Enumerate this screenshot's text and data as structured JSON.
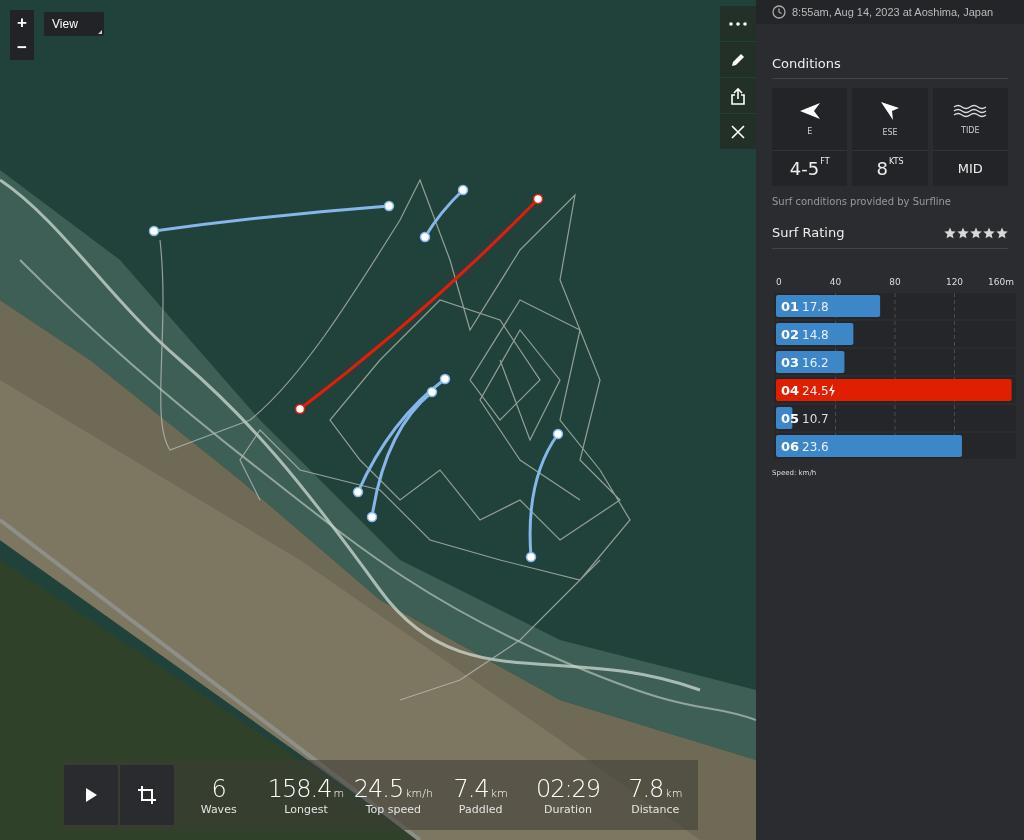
{
  "map_controls": {
    "zoom_in": "+",
    "zoom_out": "−",
    "view_menu": "View"
  },
  "tracks": [
    {
      "kind": "wave",
      "top": false
    },
    {
      "kind": "wave",
      "top": false
    },
    {
      "kind": "wave",
      "top": true
    },
    {
      "kind": "wave",
      "top": false
    },
    {
      "kind": "wave",
      "top": false
    },
    {
      "kind": "wave",
      "top": false
    }
  ],
  "stats": [
    {
      "value": "6",
      "label": "Waves"
    },
    {
      "value": "158.4",
      "unit": "m",
      "label": "Longest"
    },
    {
      "value": "24.5",
      "unit": "km/h",
      "label": "Top speed"
    },
    {
      "value": "7.4",
      "unit": "km",
      "label": "Paddled"
    },
    {
      "value": "02:29",
      "label": "Duration"
    },
    {
      "value": "7.8",
      "unit": "km",
      "label": "Distance"
    }
  ],
  "session_time": "8:55am, Aug 14, 2023 at Aoshima, Japan",
  "conditions": {
    "title": "Conditions",
    "cards": [
      {
        "kind": "swell",
        "label": "E",
        "value": "4-5",
        "unit": "FT"
      },
      {
        "kind": "wind",
        "label": "ESE",
        "value": "8",
        "unit": "KTS"
      },
      {
        "kind": "tide",
        "label": "TIDE",
        "value": "MID"
      }
    ],
    "credit": "Surf conditions provided by Surfline"
  },
  "surf_rating": {
    "title": "Surf Rating",
    "stars": 5
  },
  "waves_chart": {
    "chart_data": {
      "type": "bar",
      "orientation": "horizontal",
      "categories": [
        "01",
        "02",
        "03",
        "04",
        "05",
        "06"
      ],
      "grid": true,
      "series": [
        {
          "color": "#3d87c8",
          "values": [
            70,
            52,
            46,
            null,
            11,
            125
          ]
        },
        {
          "color": "#e01e00",
          "values": [
            null,
            null,
            null,
            158.4,
            null,
            null
          ]
        }
      ],
      "xlim": [
        0,
        160
      ],
      "xticks": [
        0,
        40,
        80,
        120,
        {
          "value": 160,
          "label": "160m"
        }
      ],
      "value_labels": [
        "17.8",
        "14.8",
        "16.2",
        "24.5",
        "10.7",
        "23.6"
      ]
    },
    "caption": "Speed: km/h"
  }
}
